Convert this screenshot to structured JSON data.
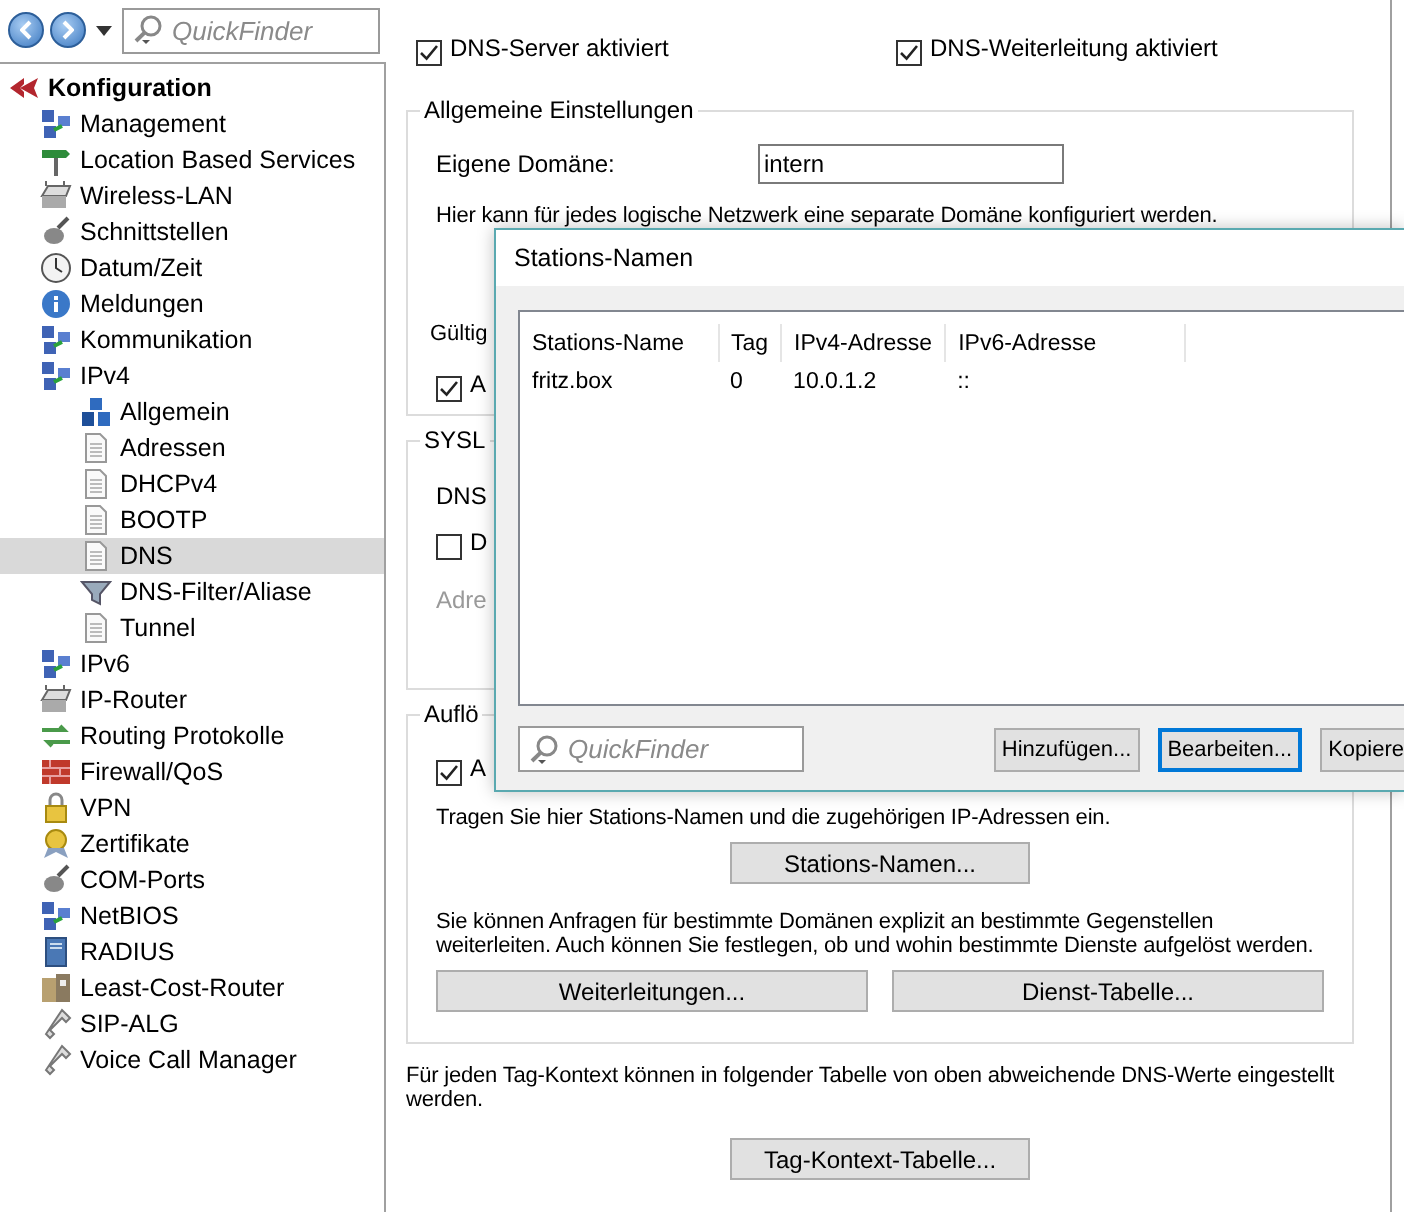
{
  "toolbar": {
    "search": {
      "placeholder": "QuickFinder"
    }
  },
  "tree": {
    "label": "Konfiguration",
    "selected": false,
    "children": [
      {
        "label": "Management",
        "selected": false
      },
      {
        "label": "Location Based Services",
        "selected": false
      },
      {
        "label": "Wireless-LAN",
        "selected": false
      },
      {
        "label": "Schnittstellen",
        "selected": false
      },
      {
        "label": "Datum/Zeit",
        "selected": false
      },
      {
        "label": "Meldungen",
        "selected": false
      },
      {
        "label": "Kommunikation",
        "selected": false
      },
      {
        "label": "IPv4",
        "selected": false,
        "children": [
          {
            "label": "Allgemein",
            "selected": false
          },
          {
            "label": "Adressen",
            "selected": false
          },
          {
            "label": "DHCPv4",
            "selected": false
          },
          {
            "label": "BOOTP",
            "selected": false
          },
          {
            "label": "DNS",
            "selected": true
          },
          {
            "label": "DNS-Filter/Aliase",
            "selected": false
          },
          {
            "label": "Tunnel",
            "selected": false
          }
        ]
      },
      {
        "label": "IPv6",
        "selected": false
      },
      {
        "label": "IP-Router",
        "selected": false
      },
      {
        "label": "Routing Protokolle",
        "selected": false
      },
      {
        "label": "Firewall/QoS",
        "selected": false
      },
      {
        "label": "VPN",
        "selected": false
      },
      {
        "label": "Zertifikate",
        "selected": false
      },
      {
        "label": "COM-Ports",
        "selected": false
      },
      {
        "label": "NetBIOS",
        "selected": false
      },
      {
        "label": "RADIUS",
        "selected": false
      },
      {
        "label": "Least-Cost-Router",
        "selected": false
      },
      {
        "label": "SIP-ALG",
        "selected": false
      },
      {
        "label": "Voice Call Manager",
        "selected": false
      }
    ]
  },
  "main": {
    "checkboxes": [
      {
        "label": "DNS-Server aktiviert",
        "checked": true
      },
      {
        "label": "DNS-Weiterleitung aktiviert",
        "checked": true
      }
    ],
    "general": {
      "title": "Allgemeine Einstellungen",
      "domain_label": "Eigene Domäne:",
      "domain_value": "intern",
      "hint": "Hier kann für jedes logische Netzwerk eine separate Domäne konfiguriert werden.",
      "validity_label": "Gültig",
      "checkbox": {
        "label": "A",
        "checked": true
      }
    },
    "syslog": {
      "title": "SYSL",
      "label": "DNS",
      "checkbox": {
        "label": "D",
        "checked": false
      },
      "address": {
        "label": "Adre",
        "disabled": true
      }
    },
    "resolution": {
      "title": "Auflö",
      "checkbox": {
        "label": "A",
        "checked": true
      },
      "hint": "Tragen Sie hier Stations-Namen und die zugehörigen IP-Adressen ein.",
      "stations_button": "Stations-Namen...",
      "forward_hint": "Sie können Anfragen für bestimmte Domänen explizit an bestimmte Gegenstellen weiterleiten. Auch können Sie festlegen, ob und wohin bestimmte Dienste aufgelöst werden.",
      "buttons": [
        "Weiterleitungen...",
        "Dienst-Tabelle..."
      ]
    },
    "tag_hint": "Für jeden Tag-Kontext können in folgender Tabelle von oben abweichende DNS-Werte eingestellt werden.",
    "tag_button": "Tag-Kontext-Tabelle..."
  },
  "dialog": {
    "title": "Stations-Namen",
    "columns": [
      "Stations-Name",
      "Tag",
      "IPv4-Adresse",
      "IPv6-Adresse"
    ],
    "rows": [
      [
        "fritz.box",
        "0",
        "10.0.1.2",
        "::"
      ]
    ],
    "search": {
      "placeholder": "QuickFinder"
    },
    "buttons": [
      {
        "label": "Hinzufügen...",
        "focused": false
      },
      {
        "label": "Bearbeiten...",
        "focused": true
      },
      {
        "label": "Kopiere",
        "focused": false
      }
    ]
  }
}
